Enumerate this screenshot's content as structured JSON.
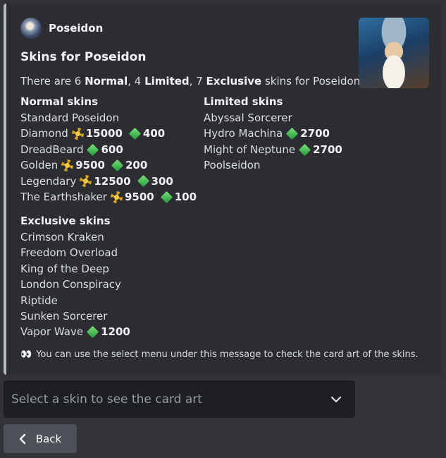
{
  "embed": {
    "author": "Poseidon",
    "title": "Skins for Poseidon",
    "description": {
      "prefix": "There are 6 ",
      "normal": "Normal",
      "comma1": ", 4 ",
      "limited": "Limited",
      "comma2": ", 7 ",
      "exclusive": "Exclusive",
      "suffix": " skins for Poseidon"
    },
    "normal_skins": {
      "title": "Normal skins",
      "items": [
        {
          "name": "Standard Poseidon"
        },
        {
          "name": "Diamond",
          "sun": "15000",
          "gem": "400"
        },
        {
          "name": "DreadBeard",
          "gem": "600"
        },
        {
          "name": "Golden",
          "sun": "9500",
          "gem": "200"
        },
        {
          "name": "Legendary",
          "sun": "12500",
          "gem": "300"
        },
        {
          "name": "The Earthshaker",
          "sun": "9500",
          "gem": "100"
        }
      ]
    },
    "limited_skins": {
      "title": "Limited skins",
      "items": [
        {
          "name": "Abyssal Sorcerer"
        },
        {
          "name": "Hydro Machina",
          "gem": "2700"
        },
        {
          "name": "Might of Neptune",
          "gem": "2700"
        },
        {
          "name": "Poolseidon"
        }
      ]
    },
    "exclusive_skins": {
      "title": "Exclusive skins",
      "items": [
        {
          "name": "Crimson Kraken"
        },
        {
          "name": "Freedom Overload"
        },
        {
          "name": "King of the Deep"
        },
        {
          "name": "London Conspiracy"
        },
        {
          "name": "Riptide"
        },
        {
          "name": "Sunken Sorcerer"
        },
        {
          "name": "Vapor Wave",
          "gem": "1200"
        }
      ]
    },
    "footer": "You can use the select menu under this message to check the card art of the skins."
  },
  "select": {
    "placeholder": "Select a skin to see the card art"
  },
  "back_button": {
    "label": "Back"
  }
}
